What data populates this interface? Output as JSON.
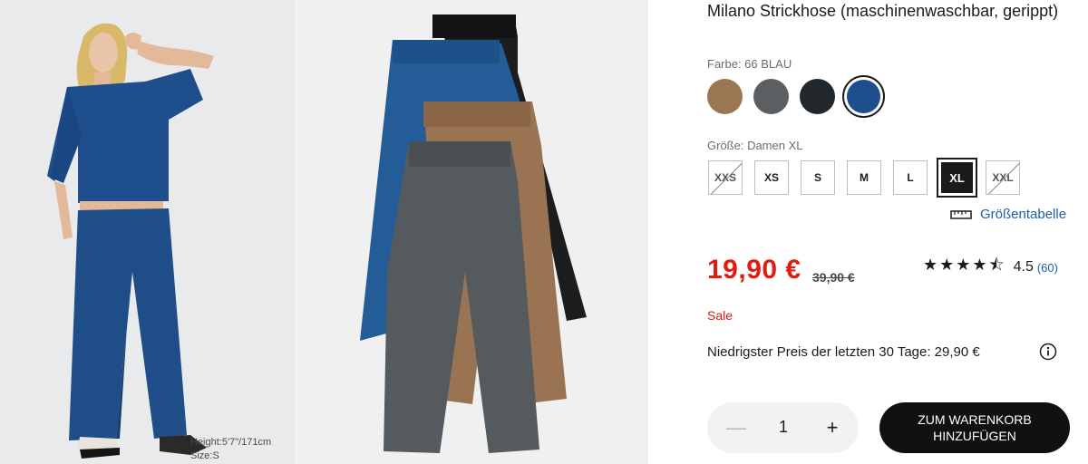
{
  "product": {
    "title": "Milano Strickhose (maschinenwaschbar, gerippt)",
    "color_label": "Farbe: 66 BLAU",
    "size_label": "Größe: Damen XL",
    "size_guide": "Größentabelle",
    "price": "19,90 €",
    "old_price": "39,90 €",
    "sale": "Sale",
    "lowest_price": "Niedrigster Preis der letzten 30 Tage: 29,90 €",
    "rating": {
      "stars": 4.5,
      "score": "4.5",
      "count": "(60)"
    },
    "quantity": "1",
    "cart_button": "ZUM WARENKORB HINZUFÜGEN"
  },
  "colors": [
    {
      "name": "brown",
      "hex": "#9b7653",
      "selected": false
    },
    {
      "name": "gray",
      "hex": "#5b5f61",
      "selected": false
    },
    {
      "name": "black",
      "hex": "#22272b",
      "selected": false
    },
    {
      "name": "blue",
      "hex": "#1f4e8c",
      "selected": true
    }
  ],
  "sizes": [
    {
      "label": "XXS",
      "state": "unavailable"
    },
    {
      "label": "XS",
      "state": "available"
    },
    {
      "label": "S",
      "state": "available"
    },
    {
      "label": "M",
      "state": "available"
    },
    {
      "label": "L",
      "state": "available"
    },
    {
      "label": "XL",
      "state": "selected"
    },
    {
      "label": "XXL",
      "state": "unavailable"
    }
  ],
  "model_info": {
    "height": "Height:5'7\"/171cm",
    "size": "Size:S"
  },
  "theme": {
    "sale_red": "#e01b0f",
    "link_blue": "#1f5fa8",
    "button_black": "#111111"
  },
  "icons": [
    "ruler-icon",
    "star-icon",
    "info-icon",
    "minus-icon",
    "plus-icon"
  ]
}
